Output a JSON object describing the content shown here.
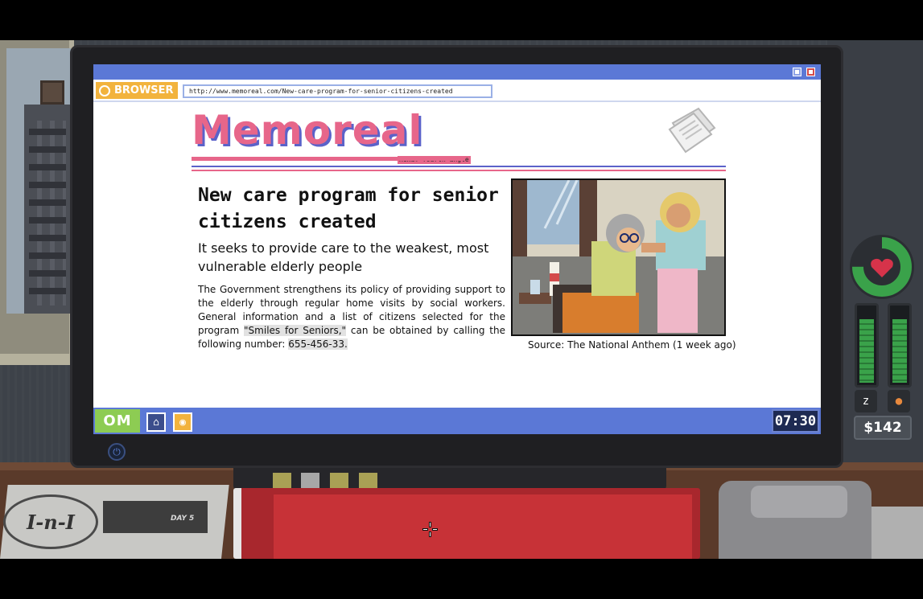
{
  "browser": {
    "label": "BROWSER",
    "url": "http://www.memoreal.com/New-care-program-for-senior-citizens-created"
  },
  "site": {
    "name": "Memoreal",
    "tagline": "Hexa© fourth angle"
  },
  "article": {
    "headline": "New care program for senior citizens created",
    "subhead": "It seeks to provide care to the weakest, most vulnerable elderly people",
    "body_before": "The Government strengthens its policy of providing support to the elderly through regular home visits by social workers. General information and a list of citizens selected for the program ",
    "program_name": "\"Smiles for Seniors,\"",
    "body_middle": " can be obtained by calling the following number: ",
    "phone_number": "655-456-33.",
    "photo_caption": "Source: The National Anthem (1 week ago)"
  },
  "taskbar": {
    "start_label": "OM",
    "clock": "07:30"
  },
  "hud": {
    "money": "$142",
    "sleep_level": 0.85,
    "food_level": 0.85,
    "health_level": 0.75
  },
  "desk": {
    "newspaper_day": "DAY 5",
    "newspaper_logo": "I-n-I"
  },
  "colors": {
    "taskbar": "#5b78d6",
    "accent_pink": "#e7668a",
    "accent_blue": "#5b62c9",
    "browser_label": "#f2b33d",
    "start_button": "#8dcc53"
  },
  "icons": {
    "browser": "browser-logo-icon",
    "home": "home-icon",
    "power": "power-icon",
    "heart": "heart-icon",
    "sleep": "sleep-icon",
    "food": "food-drumstick-icon",
    "news": "newspaper-icon",
    "cursor": "crosshair-cursor-icon"
  }
}
